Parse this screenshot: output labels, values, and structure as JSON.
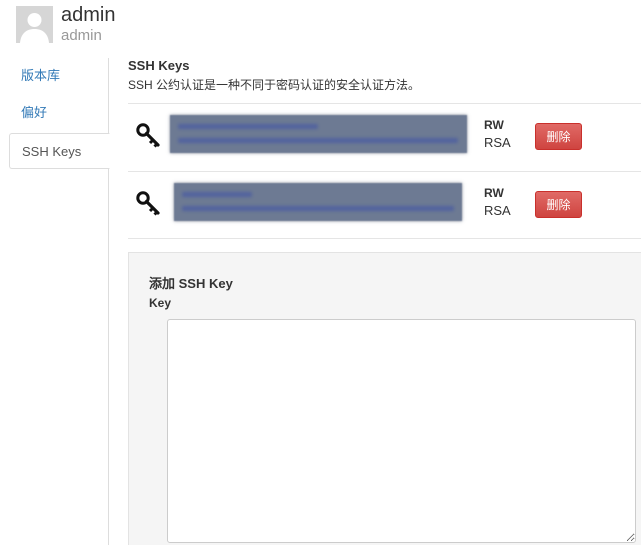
{
  "user": {
    "display_name": "admin",
    "login": "admin"
  },
  "sidebar": {
    "items": [
      {
        "label": "版本库"
      },
      {
        "label": "偏好"
      },
      {
        "label": "SSH Keys"
      }
    ]
  },
  "ssh_keys": {
    "title": "SSH Keys",
    "description": "SSH 公约认证是一种不同于密码认证的安全认证方法。",
    "keys": [
      {
        "permission": "RW",
        "type": "RSA",
        "delete_label": "删除",
        "key_icon": "key-icon"
      },
      {
        "permission": "RW",
        "type": "RSA",
        "delete_label": "删除",
        "key_icon": "key-icon"
      }
    ]
  },
  "add_key": {
    "title": "添加 SSH Key",
    "key_label": "Key",
    "key_value": ""
  },
  "colors": {
    "link": "#337ab7",
    "danger": "#d9534f",
    "panel_bg": "#f5f5f5",
    "redacted": "#6d7a93"
  }
}
